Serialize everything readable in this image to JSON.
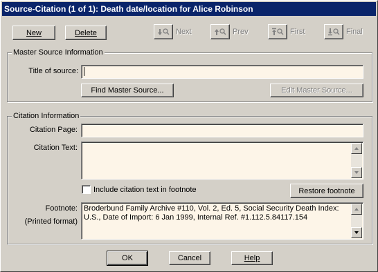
{
  "window": {
    "title": "Source-Citation (1 of 1): Death date/location for Alice Robinson"
  },
  "toolbar": {
    "new_label": "New",
    "delete_label": "Delete",
    "next_label": "Next",
    "prev_label": "Prev",
    "first_label": "First",
    "final_label": "Final"
  },
  "master_source": {
    "group_title": "Master Source Information",
    "title_label": "Title of source:",
    "title_value": "",
    "find_button": "Find Master Source...",
    "edit_button": "Edit Master Source..."
  },
  "citation": {
    "group_title": "Citation Information",
    "page_label": "Citation Page:",
    "page_value": "",
    "text_label": "Citation Text:",
    "text_value": "",
    "include_checkbox_label": "Include citation text in footnote",
    "include_checked": false,
    "restore_button": "Restore footnote",
    "footnote_label": "Footnote:",
    "footnote_sublabel": "(Printed format)",
    "footnote_value": "Broderbund Family Archive #110, Vol. 2, Ed. 5, Social Security Death Index: U.S., Date of Import: 6 Jan 1999, Internal Ref. #1.112.5.84117.154"
  },
  "footer": {
    "ok_label": "OK",
    "cancel_label": "Cancel",
    "help_label": "Help"
  },
  "colors": {
    "titlebar": "#0a246a",
    "dialog": "#d4d0c8",
    "field_bg": "#fdf5e8",
    "disabled_text": "#808080"
  }
}
